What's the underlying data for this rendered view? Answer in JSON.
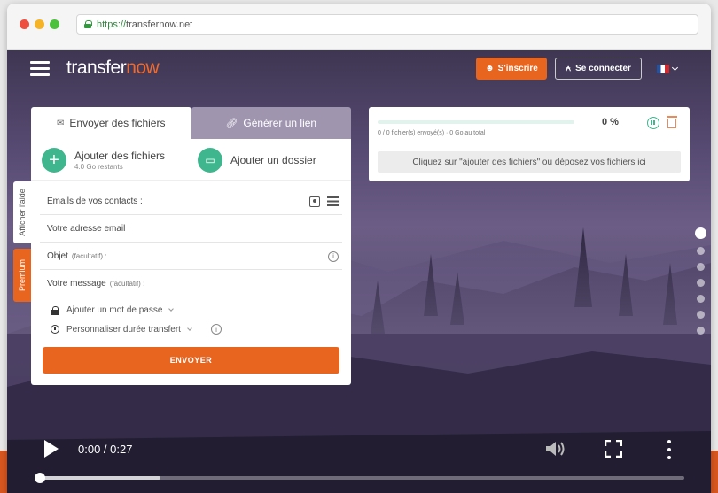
{
  "browser": {
    "url_scheme": "https://",
    "url_host": "transfernow.net"
  },
  "header": {
    "logo_main": "transfer",
    "logo_accent": "now",
    "signup_label": "S'inscrire",
    "login_label": "Se connecter",
    "language": "fr"
  },
  "side_tabs": {
    "help_label": "Afficher l'aide",
    "premium_label": "Premium"
  },
  "upload": {
    "tab_send": "Envoyer des fichiers",
    "tab_link": "Générer un lien",
    "add_files_title": "Ajouter des fichiers",
    "add_files_sub": "4.0 Go restants",
    "add_folder_title": "Ajouter un dossier",
    "contacts_label": "Emails de vos contacts :",
    "email_label": "Votre adresse email :",
    "subject_label": "Objet",
    "subject_optional": "(facultatif) :",
    "message_label": "Votre message",
    "message_optional": "(facultatif) :",
    "password_option": "Ajouter un mot de passe",
    "duration_option": "Personnaliser durée transfert",
    "send_label": "ENVOYER"
  },
  "progress": {
    "percent": "0 %",
    "percent_value": 0,
    "summary": "0 / 0 fichier(s) envoyé(s) · 0 Go au total",
    "drop_hint": "Cliquez sur \"ajouter des fichiers\" ou déposez vos fichiers ici"
  },
  "pager": {
    "count": 7,
    "active_index": 0
  },
  "video": {
    "time": "0:00 / 0:27"
  },
  "colors": {
    "accent_orange": "#e8651f",
    "accent_green": "#3fb68e"
  }
}
